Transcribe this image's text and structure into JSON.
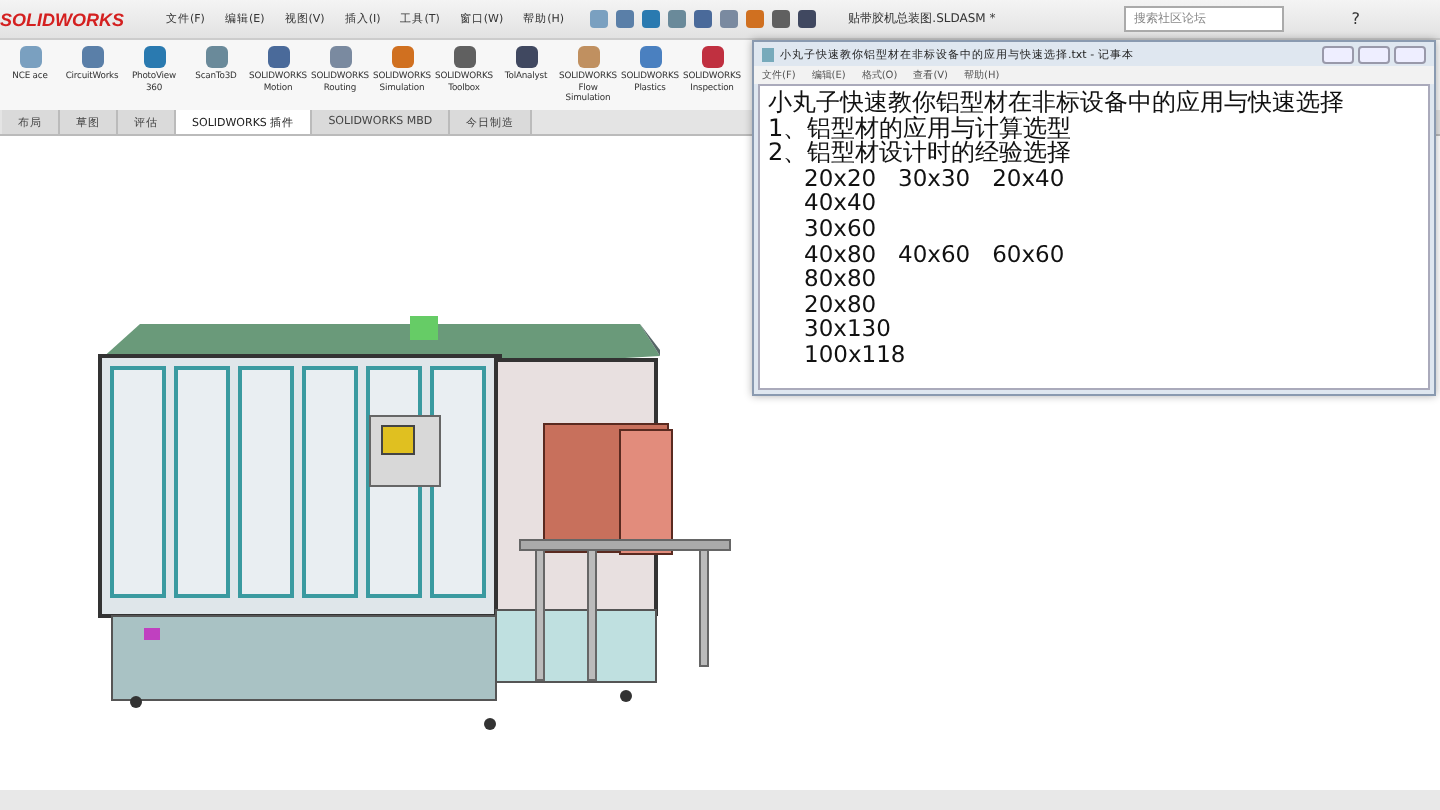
{
  "app": {
    "logo": "SOLIDWORKS",
    "menu": [
      "文件(F)",
      "编辑(E)",
      "视图(V)",
      "插入(I)",
      "工具(T)",
      "窗口(W)",
      "帮助(H)"
    ],
    "title": "贴带胶机总装图.SLDASM *",
    "search": {
      "placeholder": "搜索社区论坛"
    },
    "help": "?"
  },
  "ribbon": [
    {
      "label": "NCE ace"
    },
    {
      "label": "CircuitWorks"
    },
    {
      "label": "PhotoView 360"
    },
    {
      "label": "ScanTo3D"
    },
    {
      "label": "SOLIDWORKS Motion"
    },
    {
      "label": "SOLIDWORKS Routing"
    },
    {
      "label": "SOLIDWORKS Simulation"
    },
    {
      "label": "SOLIDWORKS Toolbox"
    },
    {
      "label": "TolAnalyst"
    },
    {
      "label": "SOLIDWORKS Flow Simulation"
    },
    {
      "label": "SOLIDWORKS Plastics"
    },
    {
      "label": "SOLIDWORKS Inspection"
    }
  ],
  "tabs": [
    {
      "label": "布局",
      "selected": false
    },
    {
      "label": "草图",
      "selected": false
    },
    {
      "label": "评估",
      "selected": false
    },
    {
      "label": "SOLIDWORKS 插件",
      "selected": true
    },
    {
      "label": "SOLIDWORKS MBD",
      "selected": false
    },
    {
      "label": "今日制造",
      "selected": false
    }
  ],
  "notepad": {
    "title": "小丸子快速教你铝型材在非标设备中的应用与快速选择.txt - 记事本",
    "menu": [
      "文件(F)",
      "编辑(E)",
      "格式(O)",
      "查看(V)",
      "帮助(H)"
    ],
    "lines": [
      {
        "kind": "text",
        "text": "小丸子快速教你铝型材在非标设备中的应用与快速选择"
      },
      {
        "kind": "text",
        "text": "1、铝型材的应用与计算选型"
      },
      {
        "kind": "text",
        "text": "2、铝型材设计时的经验选择"
      },
      {
        "kind": "size",
        "text": "20x20   30x30   20x40"
      },
      {
        "kind": "size",
        "text": "40x40"
      },
      {
        "kind": "size",
        "text": "30x60"
      },
      {
        "kind": "size",
        "text": "40x80   40x60   60x60"
      },
      {
        "kind": "size",
        "text": "80x80"
      },
      {
        "kind": "size",
        "text": "20x80"
      },
      {
        "kind": "size",
        "text": "30x130"
      },
      {
        "kind": "size",
        "text": "100x118"
      }
    ]
  }
}
